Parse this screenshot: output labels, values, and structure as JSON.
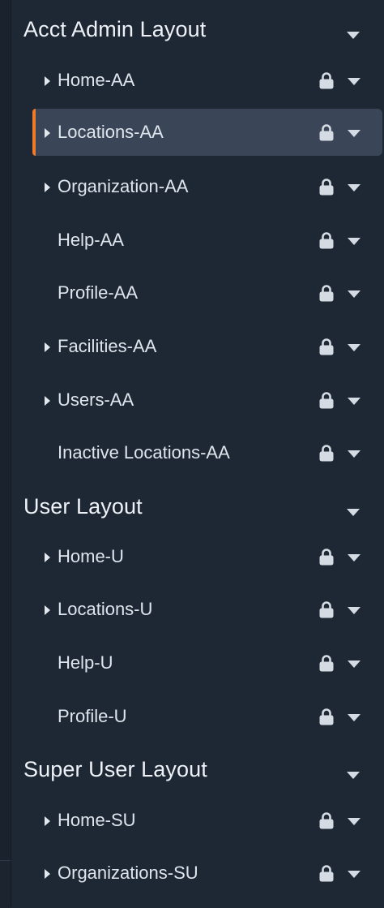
{
  "groups": [
    {
      "title": "Acct Admin Layout",
      "items": [
        {
          "label": "Home-AA",
          "expandable": true,
          "active": false
        },
        {
          "label": "Locations-AA",
          "expandable": true,
          "active": true
        },
        {
          "label": "Organization-AA",
          "expandable": true,
          "active": false
        },
        {
          "label": "Help-AA",
          "expandable": false,
          "active": false
        },
        {
          "label": "Profile-AA",
          "expandable": false,
          "active": false
        },
        {
          "label": "Facilities-AA",
          "expandable": true,
          "active": false
        },
        {
          "label": "Users-AA",
          "expandable": true,
          "active": false
        },
        {
          "label": "Inactive Locations-AA",
          "expandable": false,
          "active": false
        }
      ]
    },
    {
      "title": "User Layout",
      "items": [
        {
          "label": "Home-U",
          "expandable": true,
          "active": false
        },
        {
          "label": "Locations-U",
          "expandable": true,
          "active": false
        },
        {
          "label": "Help-U",
          "expandable": false,
          "active": false
        },
        {
          "label": "Profile-U",
          "expandable": false,
          "active": false
        }
      ]
    },
    {
      "title": "Super User Layout",
      "items": [
        {
          "label": "Home-SU",
          "expandable": true,
          "active": false
        },
        {
          "label": "Organizations-SU",
          "expandable": true,
          "active": false
        }
      ]
    }
  ],
  "icons": {
    "lock": "lock-icon",
    "dropdown": "caret-down-icon",
    "expand": "caret-right-icon"
  },
  "colors": {
    "background": "#1e2835",
    "active_item": "#3a4658",
    "active_accent": "#ef7a2a"
  }
}
